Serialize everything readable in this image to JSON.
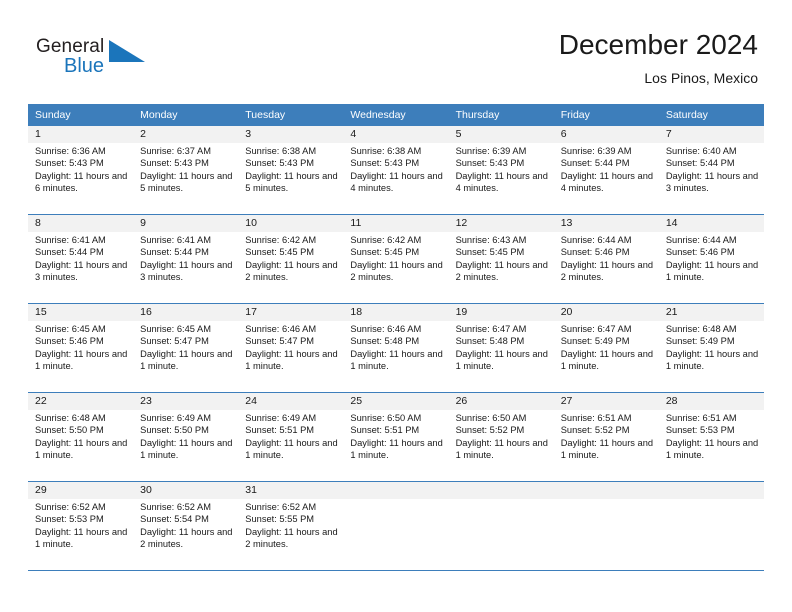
{
  "brand": {
    "name_top": "General",
    "name_bottom": "Blue",
    "triangle_color": "#1b75bb",
    "text_color": "#231f20"
  },
  "header": {
    "title": "December 2024",
    "subtitle": "Los Pinos, Mexico"
  },
  "theme": {
    "header_bg": "#3d7ebb",
    "header_text": "#ffffff",
    "daynum_bg": "#f2f2f2",
    "cell_bg": "#ffffff",
    "text": "#1a1a1a",
    "separator": "#3d7ebb"
  },
  "weekdays": [
    "Sunday",
    "Monday",
    "Tuesday",
    "Wednesday",
    "Thursday",
    "Friday",
    "Saturday"
  ],
  "labels": {
    "sunrise_prefix": "Sunrise:",
    "sunset_prefix": "Sunset:",
    "daylight_prefix": "Daylight:"
  },
  "weeks": [
    {
      "days": [
        {
          "num": "1",
          "sunrise": "Sunrise: 6:36 AM",
          "sunset": "Sunset: 5:43 PM",
          "daylight": "Daylight: 11 hours and 6 minutes."
        },
        {
          "num": "2",
          "sunrise": "Sunrise: 6:37 AM",
          "sunset": "Sunset: 5:43 PM",
          "daylight": "Daylight: 11 hours and 5 minutes."
        },
        {
          "num": "3",
          "sunrise": "Sunrise: 6:38 AM",
          "sunset": "Sunset: 5:43 PM",
          "daylight": "Daylight: 11 hours and 5 minutes."
        },
        {
          "num": "4",
          "sunrise": "Sunrise: 6:38 AM",
          "sunset": "Sunset: 5:43 PM",
          "daylight": "Daylight: 11 hours and 4 minutes."
        },
        {
          "num": "5",
          "sunrise": "Sunrise: 6:39 AM",
          "sunset": "Sunset: 5:43 PM",
          "daylight": "Daylight: 11 hours and 4 minutes."
        },
        {
          "num": "6",
          "sunrise": "Sunrise: 6:39 AM",
          "sunset": "Sunset: 5:44 PM",
          "daylight": "Daylight: 11 hours and 4 minutes."
        },
        {
          "num": "7",
          "sunrise": "Sunrise: 6:40 AM",
          "sunset": "Sunset: 5:44 PM",
          "daylight": "Daylight: 11 hours and 3 minutes."
        }
      ]
    },
    {
      "days": [
        {
          "num": "8",
          "sunrise": "Sunrise: 6:41 AM",
          "sunset": "Sunset: 5:44 PM",
          "daylight": "Daylight: 11 hours and 3 minutes."
        },
        {
          "num": "9",
          "sunrise": "Sunrise: 6:41 AM",
          "sunset": "Sunset: 5:44 PM",
          "daylight": "Daylight: 11 hours and 3 minutes."
        },
        {
          "num": "10",
          "sunrise": "Sunrise: 6:42 AM",
          "sunset": "Sunset: 5:45 PM",
          "daylight": "Daylight: 11 hours and 2 minutes."
        },
        {
          "num": "11",
          "sunrise": "Sunrise: 6:42 AM",
          "sunset": "Sunset: 5:45 PM",
          "daylight": "Daylight: 11 hours and 2 minutes."
        },
        {
          "num": "12",
          "sunrise": "Sunrise: 6:43 AM",
          "sunset": "Sunset: 5:45 PM",
          "daylight": "Daylight: 11 hours and 2 minutes."
        },
        {
          "num": "13",
          "sunrise": "Sunrise: 6:44 AM",
          "sunset": "Sunset: 5:46 PM",
          "daylight": "Daylight: 11 hours and 2 minutes."
        },
        {
          "num": "14",
          "sunrise": "Sunrise: 6:44 AM",
          "sunset": "Sunset: 5:46 PM",
          "daylight": "Daylight: 11 hours and 1 minute."
        }
      ]
    },
    {
      "days": [
        {
          "num": "15",
          "sunrise": "Sunrise: 6:45 AM",
          "sunset": "Sunset: 5:46 PM",
          "daylight": "Daylight: 11 hours and 1 minute."
        },
        {
          "num": "16",
          "sunrise": "Sunrise: 6:45 AM",
          "sunset": "Sunset: 5:47 PM",
          "daylight": "Daylight: 11 hours and 1 minute."
        },
        {
          "num": "17",
          "sunrise": "Sunrise: 6:46 AM",
          "sunset": "Sunset: 5:47 PM",
          "daylight": "Daylight: 11 hours and 1 minute."
        },
        {
          "num": "18",
          "sunrise": "Sunrise: 6:46 AM",
          "sunset": "Sunset: 5:48 PM",
          "daylight": "Daylight: 11 hours and 1 minute."
        },
        {
          "num": "19",
          "sunrise": "Sunrise: 6:47 AM",
          "sunset": "Sunset: 5:48 PM",
          "daylight": "Daylight: 11 hours and 1 minute."
        },
        {
          "num": "20",
          "sunrise": "Sunrise: 6:47 AM",
          "sunset": "Sunset: 5:49 PM",
          "daylight": "Daylight: 11 hours and 1 minute."
        },
        {
          "num": "21",
          "sunrise": "Sunrise: 6:48 AM",
          "sunset": "Sunset: 5:49 PM",
          "daylight": "Daylight: 11 hours and 1 minute."
        }
      ]
    },
    {
      "days": [
        {
          "num": "22",
          "sunrise": "Sunrise: 6:48 AM",
          "sunset": "Sunset: 5:50 PM",
          "daylight": "Daylight: 11 hours and 1 minute."
        },
        {
          "num": "23",
          "sunrise": "Sunrise: 6:49 AM",
          "sunset": "Sunset: 5:50 PM",
          "daylight": "Daylight: 11 hours and 1 minute."
        },
        {
          "num": "24",
          "sunrise": "Sunrise: 6:49 AM",
          "sunset": "Sunset: 5:51 PM",
          "daylight": "Daylight: 11 hours and 1 minute."
        },
        {
          "num": "25",
          "sunrise": "Sunrise: 6:50 AM",
          "sunset": "Sunset: 5:51 PM",
          "daylight": "Daylight: 11 hours and 1 minute."
        },
        {
          "num": "26",
          "sunrise": "Sunrise: 6:50 AM",
          "sunset": "Sunset: 5:52 PM",
          "daylight": "Daylight: 11 hours and 1 minute."
        },
        {
          "num": "27",
          "sunrise": "Sunrise: 6:51 AM",
          "sunset": "Sunset: 5:52 PM",
          "daylight": "Daylight: 11 hours and 1 minute."
        },
        {
          "num": "28",
          "sunrise": "Sunrise: 6:51 AM",
          "sunset": "Sunset: 5:53 PM",
          "daylight": "Daylight: 11 hours and 1 minute."
        }
      ]
    },
    {
      "days": [
        {
          "num": "29",
          "sunrise": "Sunrise: 6:52 AM",
          "sunset": "Sunset: 5:53 PM",
          "daylight": "Daylight: 11 hours and 1 minute."
        },
        {
          "num": "30",
          "sunrise": "Sunrise: 6:52 AM",
          "sunset": "Sunset: 5:54 PM",
          "daylight": "Daylight: 11 hours and 2 minutes."
        },
        {
          "num": "31",
          "sunrise": "Sunrise: 6:52 AM",
          "sunset": "Sunset: 5:55 PM",
          "daylight": "Daylight: 11 hours and 2 minutes."
        },
        {
          "num": "",
          "sunrise": "",
          "sunset": "",
          "daylight": ""
        },
        {
          "num": "",
          "sunrise": "",
          "sunset": "",
          "daylight": ""
        },
        {
          "num": "",
          "sunrise": "",
          "sunset": "",
          "daylight": ""
        },
        {
          "num": "",
          "sunrise": "",
          "sunset": "",
          "daylight": ""
        }
      ]
    }
  ]
}
